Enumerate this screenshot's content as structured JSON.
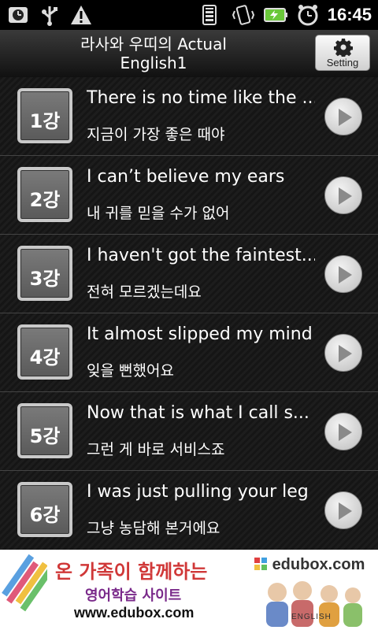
{
  "status": {
    "time": "16:45"
  },
  "header": {
    "title_line1": "라사와 우띠의  Actual",
    "title_line2": "English1",
    "setting_label": "Setting"
  },
  "lessons": [
    {
      "badge": "1강",
      "en": "There is no time like the ...",
      "ko": "지금이 가장 좋은 때야"
    },
    {
      "badge": "2강",
      "en": "I can’t believe my ears",
      "ko": "내 귀를 믿을 수가 없어"
    },
    {
      "badge": "3강",
      "en": "I haven't got the faintest...",
      "ko": "전혀 모르겠는데요"
    },
    {
      "badge": "4강",
      "en": "It almost slipped my mind",
      "ko": "잊을 뻔했어요"
    },
    {
      "badge": "5강",
      "en": "Now that is what I call s...",
      "ko": "그런 게 바로 서비스죠"
    },
    {
      "badge": "6강",
      "en": "I was just pulling your leg",
      "ko": "그냥 농담해 본거에요"
    }
  ],
  "ad": {
    "headline": "온 가족이 함께하는",
    "subline": "영어학습 사이트",
    "url": "www.edubox.com",
    "brand": "edubox.com",
    "tag": "ENGLISH"
  },
  "colors": {
    "ad_headline": "#d03838",
    "ad_subline": "#7a2a8a"
  }
}
